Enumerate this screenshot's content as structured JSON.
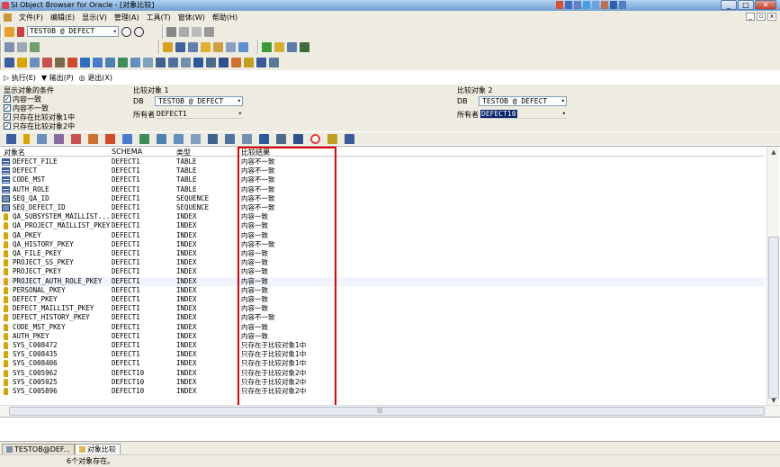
{
  "window": {
    "title": "SI Object Browser for Oracle - [对象比较]",
    "buttons": [
      "_",
      "□",
      "✕"
    ]
  },
  "menu": {
    "items": [
      "文件(F)",
      "编辑(E)",
      "显示(V)",
      "管理(A)",
      "工具(T)",
      "窗体(W)",
      "帮助(H)"
    ],
    "mdi_buttons": [
      "_",
      "▫",
      "x"
    ]
  },
  "toolbar": {
    "connection": "TESTOB @ DEFECT"
  },
  "actions": {
    "execute": "执行(E)",
    "output": "输出(P)",
    "exit": "退出(X)"
  },
  "conditions": {
    "title": "显示对象的条件",
    "options": [
      {
        "label": "内容一致",
        "checked": true
      },
      {
        "label": "内容不一致",
        "checked": true
      },
      {
        "label": "只存在比较对象1中",
        "checked": true
      },
      {
        "label": "只存在比较对象2中",
        "checked": true
      }
    ]
  },
  "compare1": {
    "title": "比较对象 1",
    "db_label": "DB",
    "db_value": "TESTOB @ DEFECT",
    "owner_label": "所有者",
    "owner_value": "DEFECT1"
  },
  "compare2": {
    "title": "比较对象 2",
    "db_label": "DB",
    "db_value": "TESTOB @ DEFECT",
    "owner_label": "所有者",
    "owner_value": "DEFECT10"
  },
  "grid": {
    "columns": [
      "对象名",
      "SCHEMA",
      "类型",
      "比较结果"
    ],
    "rows": [
      {
        "icon": "table",
        "name": "DEFECT_FILE",
        "schema": "DEFECT1",
        "type": "TABLE",
        "result": "内容不一致"
      },
      {
        "icon": "table",
        "name": "DEFECT",
        "schema": "DEFECT1",
        "type": "TABLE",
        "result": "内容不一致"
      },
      {
        "icon": "table",
        "name": "CODE_MST",
        "schema": "DEFECT1",
        "type": "TABLE",
        "result": "内容不一致"
      },
      {
        "icon": "table",
        "name": "AUTH_ROLE",
        "schema": "DEFECT1",
        "type": "TABLE",
        "result": "内容不一致"
      },
      {
        "icon": "seq",
        "name": "SEQ_QA_ID",
        "schema": "DEFECT1",
        "type": "SEQUENCE",
        "result": "内容不一致"
      },
      {
        "icon": "seq",
        "name": "SEQ_DEFECT_ID",
        "schema": "DEFECT1",
        "type": "SEQUENCE",
        "result": "内容不一致"
      },
      {
        "icon": "key",
        "name": "QA_SUBSYSTEM_MAILLIST...",
        "schema": "DEFECT1",
        "type": "INDEX",
        "result": "内容一致"
      },
      {
        "icon": "key",
        "name": "QA_PROJECT_MAILLIST_PKEY",
        "schema": "DEFECT1",
        "type": "INDEX",
        "result": "内容一致"
      },
      {
        "icon": "key",
        "name": "QA_PKEY",
        "schema": "DEFECT1",
        "type": "INDEX",
        "result": "内容一致"
      },
      {
        "icon": "key",
        "name": "QA_HISTORY_PKEY",
        "schema": "DEFECT1",
        "type": "INDEX",
        "result": "内容不一致"
      },
      {
        "icon": "key",
        "name": "QA_FILE_PKEY",
        "schema": "DEFECT1",
        "type": "INDEX",
        "result": "内容一致"
      },
      {
        "icon": "key",
        "name": "PROJECT_SS_PKEY",
        "schema": "DEFECT1",
        "type": "INDEX",
        "result": "内容一致"
      },
      {
        "icon": "key",
        "name": "PROJECT_PKEY",
        "schema": "DEFECT1",
        "type": "INDEX",
        "result": "内容一致"
      },
      {
        "icon": "key",
        "name": "PROJECT_AUTH_ROLE_PKEY",
        "schema": "DEFECT1",
        "type": "INDEX",
        "result": "内容一致"
      },
      {
        "icon": "key",
        "name": "PERSONAL_PKEY",
        "schema": "DEFECT1",
        "type": "INDEX",
        "result": "内容一致"
      },
      {
        "icon": "key",
        "name": "DEFECT_PKEY",
        "schema": "DEFECT1",
        "type": "INDEX",
        "result": "内容一致"
      },
      {
        "icon": "key",
        "name": "DEFECT_MAILLIST_PKEY",
        "schema": "DEFECT1",
        "type": "INDEX",
        "result": "内容一致"
      },
      {
        "icon": "key",
        "name": "DEFECT_HISTORY_PKEY",
        "schema": "DEFECT1",
        "type": "INDEX",
        "result": "内容不一致"
      },
      {
        "icon": "key",
        "name": "CODE_MST_PKEY",
        "schema": "DEFECT1",
        "type": "INDEX",
        "result": "内容一致"
      },
      {
        "icon": "key",
        "name": "AUTH_PKEY",
        "schema": "DEFECT1",
        "type": "INDEX",
        "result": "内容一致"
      },
      {
        "icon": "key",
        "name": "SYS_C008472",
        "schema": "DEFECT1",
        "type": "INDEX",
        "result": "只存在于比较对象1中"
      },
      {
        "icon": "key",
        "name": "SYS_C008435",
        "schema": "DEFECT1",
        "type": "INDEX",
        "result": "只存在于比较对象1中"
      },
      {
        "icon": "key",
        "name": "SYS_C008406",
        "schema": "DEFECT1",
        "type": "INDEX",
        "result": "只存在于比较对象1中"
      },
      {
        "icon": "key",
        "name": "SYS_C005962",
        "schema": "DEFECT10",
        "type": "INDEX",
        "result": "只存在于比较对象2中"
      },
      {
        "icon": "key",
        "name": "SYS_C005925",
        "schema": "DEFECT10",
        "type": "INDEX",
        "result": "只存在于比较对象2中"
      },
      {
        "icon": "key",
        "name": "SYS_C005896",
        "schema": "DEFECT10",
        "type": "INDEX",
        "result": "只存在于比较对象2中"
      }
    ],
    "selected_row": 13
  },
  "hscroll_label": "|||",
  "tabs": [
    {
      "label": "TESTOB@DEF..."
    },
    {
      "label": "对象比较"
    }
  ],
  "status": "6个对象存在。",
  "colors": {
    "highlight": "#e00000",
    "chrome": "#eeebe0",
    "selection": "#0a246a"
  }
}
